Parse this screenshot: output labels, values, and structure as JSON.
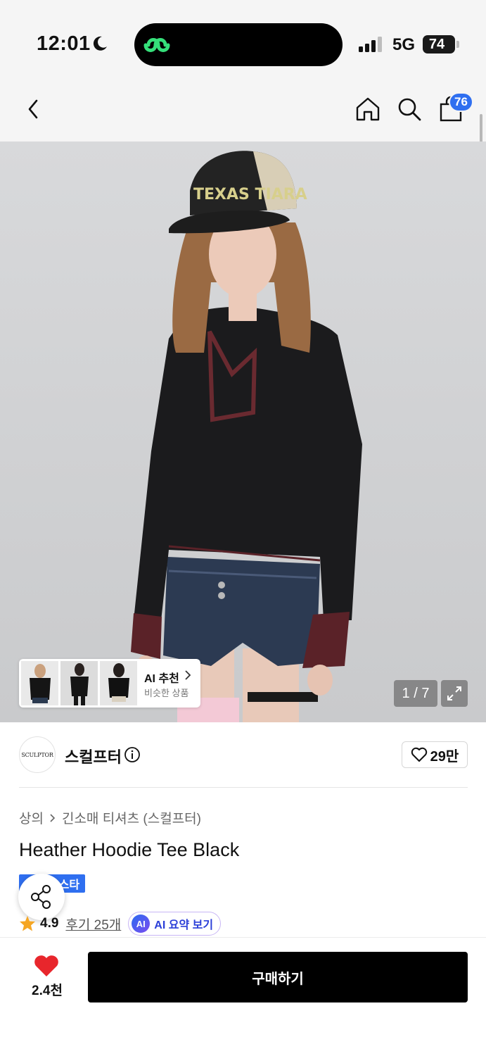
{
  "status_bar": {
    "time": "12:01",
    "network": "5G",
    "battery": "74"
  },
  "nav": {
    "cart_count": "76"
  },
  "gallery": {
    "ai_recommend_title": "AI 추천",
    "ai_recommend_sub": "비슷한 상품",
    "counter": "1 / 7",
    "hat_text": "TEXAS TIARA"
  },
  "brand": {
    "logo_text": "SCULPTOR",
    "name": "스컬프터",
    "likes": "29만"
  },
  "product": {
    "category": "상의",
    "subcategory": "긴소매 티셔츠 (스컬프터)",
    "title": "Heather Hoodie Tee Black",
    "tag": "무신사 스타",
    "rating": "4.9",
    "reviews": "후기 25개",
    "ai_summary": "AI 요약 보기",
    "ai_badge": "AI"
  },
  "bottom": {
    "wish_count": "2.4천",
    "buy_label": "구매하기"
  },
  "colors": {
    "accent": "#2f6ff0",
    "heart": "#e8262c",
    "star": "#f5a623",
    "buy_bg": "#000000"
  }
}
